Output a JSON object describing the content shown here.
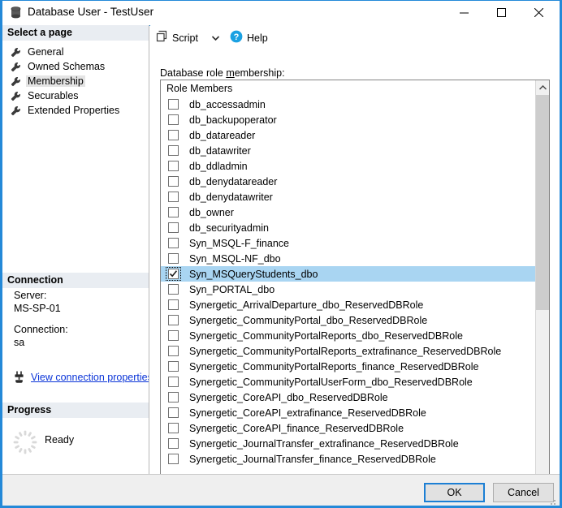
{
  "window": {
    "title": "Database User - TestUser",
    "icon": "database-icon",
    "controls": {
      "minimize": "minimize-icon",
      "maximize": "maximize-icon",
      "close": "close-icon"
    }
  },
  "sidebar": {
    "select_page_header": "Select a page",
    "pages": [
      {
        "label": "General",
        "selected": false
      },
      {
        "label": "Owned Schemas",
        "selected": false
      },
      {
        "label": "Membership",
        "selected": true
      },
      {
        "label": "Securables",
        "selected": false
      },
      {
        "label": "Extended Properties",
        "selected": false
      }
    ],
    "connection": {
      "header": "Connection",
      "server_label": "Server:",
      "server_value": "MS-SP-01",
      "connection_label": "Connection:",
      "connection_value": "sa",
      "link_text": "View connection properties",
      "link_icon": "plug-icon",
      "link_color": "#0a34d8"
    },
    "progress": {
      "header": "Progress",
      "status": "Ready",
      "spinner_icon": "spinner-icon"
    }
  },
  "toolbar": {
    "script_label": "Script",
    "script_icon": "script-icon",
    "script_dropdown_icon": "chevron-down-icon",
    "help_label": "Help",
    "help_icon": "help-question-icon",
    "help_icon_color": "#1ba1e2"
  },
  "main": {
    "list_label_prefix": "Database role ",
    "list_label_accesskey": "m",
    "list_label_suffix": "embership:",
    "column_header": "Role Members",
    "selection_color": "#a9d5f2",
    "rows": [
      {
        "name": "db_accessadmin",
        "checked": false,
        "selected": false
      },
      {
        "name": "db_backupoperator",
        "checked": false,
        "selected": false
      },
      {
        "name": "db_datareader",
        "checked": false,
        "selected": false
      },
      {
        "name": "db_datawriter",
        "checked": false,
        "selected": false
      },
      {
        "name": "db_ddladmin",
        "checked": false,
        "selected": false
      },
      {
        "name": "db_denydatareader",
        "checked": false,
        "selected": false
      },
      {
        "name": "db_denydatawriter",
        "checked": false,
        "selected": false
      },
      {
        "name": "db_owner",
        "checked": false,
        "selected": false
      },
      {
        "name": "db_securityadmin",
        "checked": false,
        "selected": false
      },
      {
        "name": "Syn_MSQL-F_finance",
        "checked": false,
        "selected": false
      },
      {
        "name": "Syn_MSQL-NF_dbo",
        "checked": false,
        "selected": false
      },
      {
        "name": "Syn_MSQueryStudents_dbo",
        "checked": true,
        "selected": true
      },
      {
        "name": "Syn_PORTAL_dbo",
        "checked": false,
        "selected": false
      },
      {
        "name": "Synergetic_ArrivalDeparture_dbo_ReservedDBRole",
        "checked": false,
        "selected": false
      },
      {
        "name": "Synergetic_CommunityPortal_dbo_ReservedDBRole",
        "checked": false,
        "selected": false
      },
      {
        "name": "Synergetic_CommunityPortalReports_dbo_ReservedDBRole",
        "checked": false,
        "selected": false
      },
      {
        "name": "Synergetic_CommunityPortalReports_extrafinance_ReservedDBRole",
        "checked": false,
        "selected": false
      },
      {
        "name": "Synergetic_CommunityPortalReports_finance_ReservedDBRole",
        "checked": false,
        "selected": false
      },
      {
        "name": "Synergetic_CommunityPortalUserForm_dbo_ReservedDBRole",
        "checked": false,
        "selected": false
      },
      {
        "name": "Synergetic_CoreAPI_dbo_ReservedDBRole",
        "checked": false,
        "selected": false
      },
      {
        "name": "Synergetic_CoreAPI_extrafinance_ReservedDBRole",
        "checked": false,
        "selected": false
      },
      {
        "name": "Synergetic_CoreAPI_finance_ReservedDBRole",
        "checked": false,
        "selected": false
      },
      {
        "name": "Synergetic_JournalTransfer_extrafinance_ReservedDBRole",
        "checked": false,
        "selected": false
      },
      {
        "name": "Synergetic_JournalTransfer_finance_ReservedDBRole",
        "checked": false,
        "selected": false
      }
    ],
    "scrollbar": {
      "up_icon": "chevron-up-icon",
      "down_icon": "chevron-down-icon"
    }
  },
  "footer": {
    "ok_label": "OK",
    "cancel_label": "Cancel",
    "resize_grip": "resize-grip-icon"
  }
}
